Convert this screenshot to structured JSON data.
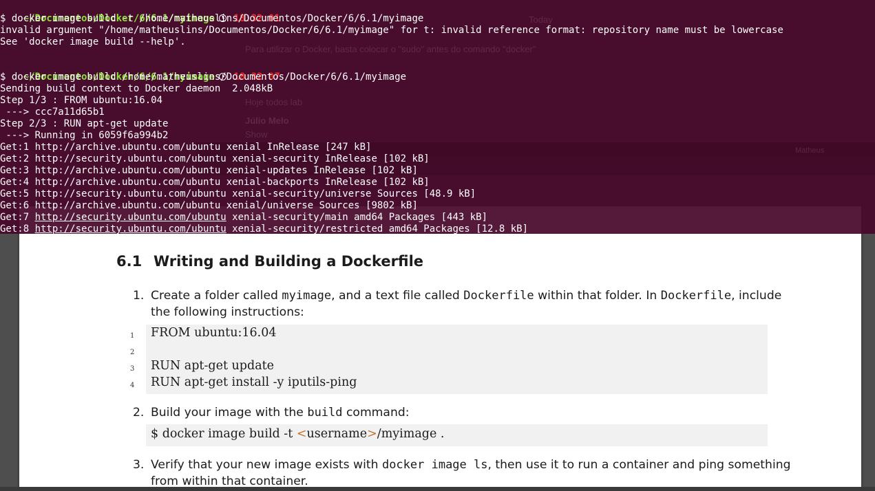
{
  "document": {
    "section_number": "6.1",
    "section_title": "Writing and Building a Dockerfile",
    "item1": {
      "num": "1.",
      "line1_a": "Create a folder called ",
      "line1_code1": "myimage",
      "line1_b": ", and a text file called ",
      "line1_code2": "Dockerfile",
      "line1_c": " within that folder. In ",
      "line1_code3": "Dockerfile",
      "line1_d": ", include",
      "line2": "the following instructions:"
    },
    "dockerfile_lines": [
      {
        "no": "1",
        "text": "FROM ubuntu:16.04"
      },
      {
        "no": "2",
        "text": ""
      },
      {
        "no": "3",
        "text": "RUN apt-get update"
      },
      {
        "no": "4",
        "text": "RUN apt-get install -y iputils-ping"
      }
    ],
    "item2": {
      "num": "2.",
      "text_a": "Build your image with the ",
      "code": "build",
      "text_b": " command:"
    },
    "build_cmd": {
      "a": "$ docker image build -t ",
      "lt": "<",
      "user": "username",
      "gt": ">",
      "b": "/myimage ."
    },
    "item3": {
      "num": "3.",
      "line1_a": "Verify that your new image exists with ",
      "line1_code": "docker image ls",
      "line1_b": ", then use it to run a container and ping something",
      "line2": "from within that container."
    }
  },
  "terminal": {
    "prompt1": {
      "path": "~/Documentos/Docker/6/6.1/myimage",
      "time": "18:32:01"
    },
    "lines_block1": [
      "$ docker image build -t /home/matheuslins/Documentos/Docker/6/6.1/myimage",
      "invalid argument \"/home/matheuslins/Documentos/Docker/6/6.1/myimage\" for t: invalid reference format: repository name must be lowercase",
      "See 'docker image build --help'."
    ],
    "prompt2": {
      "path": "~/Documentos/Docker/6/6.1/myimage",
      "time": "18:32:07"
    },
    "lines_block2": [
      "$ docker image build /home/matheuslins/Documentos/Docker/6/6.1/myimage",
      "Sending build context to Docker daemon  2.048kB",
      "Step 1/3 : FROM ubuntu:16.04",
      " ---> ccc7a11d65b1",
      "Step 2/3 : RUN apt-get update",
      " ---> Running in 6059f6a994b2",
      "Get:1 http://archive.ubuntu.com/ubuntu xenial InRelease [247 kB]",
      "Get:2 http://security.ubuntu.com/ubuntu xenial-security InRelease [102 kB]",
      "Get:3 http://archive.ubuntu.com/ubuntu xenial-updates InRelease [102 kB]",
      "Get:4 http://archive.ubuntu.com/ubuntu xenial-backports InRelease [102 kB]",
      "Get:5 http://security.ubuntu.com/ubuntu xenial-security/universe Sources [48.9 kB]",
      "Get:6 http://archive.ubuntu.com/ubuntu xenial/universe Sources [9802 kB]"
    ],
    "get7": {
      "pre": "Get:7 ",
      "url": "http://security.ubuntu.com/ubuntu",
      "post": " xenial-security/main amd64 Packages [443 kB]"
    },
    "get8": {
      "pre": "Get:8 ",
      "url": "http://security.ubuntu.com/ubuntu",
      "post": " xenial-security/restricted amd64 Packages [12.8 kB]"
    }
  },
  "background_ghost": {
    "today": "Today",
    "note": "Para utilizar o Docker, basta colocar o \"sudo\" antes do comando \"docker\"",
    "msg1": "Hoje todos lab",
    "user2": "Júlio Melo",
    "msg2": "Show",
    "profile": "Matheus"
  },
  "colors": {
    "terminal_bg": "#48082a",
    "prompt_path": "#8ae234",
    "prompt_time": "#ef2929",
    "angle_brackets": "#c0702a"
  }
}
